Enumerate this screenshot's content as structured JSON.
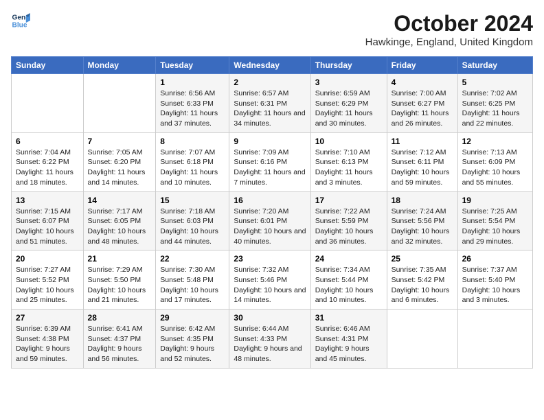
{
  "logo": {
    "line1": "General",
    "line2": "Blue"
  },
  "title": "October 2024",
  "subtitle": "Hawkinge, England, United Kingdom",
  "days_header": [
    "Sunday",
    "Monday",
    "Tuesday",
    "Wednesday",
    "Thursday",
    "Friday",
    "Saturday"
  ],
  "weeks": [
    [
      {
        "day": "",
        "sunrise": "",
        "sunset": "",
        "daylight": ""
      },
      {
        "day": "",
        "sunrise": "",
        "sunset": "",
        "daylight": ""
      },
      {
        "day": "1",
        "sunrise": "Sunrise: 6:56 AM",
        "sunset": "Sunset: 6:33 PM",
        "daylight": "Daylight: 11 hours and 37 minutes."
      },
      {
        "day": "2",
        "sunrise": "Sunrise: 6:57 AM",
        "sunset": "Sunset: 6:31 PM",
        "daylight": "Daylight: 11 hours and 34 minutes."
      },
      {
        "day": "3",
        "sunrise": "Sunrise: 6:59 AM",
        "sunset": "Sunset: 6:29 PM",
        "daylight": "Daylight: 11 hours and 30 minutes."
      },
      {
        "day": "4",
        "sunrise": "Sunrise: 7:00 AM",
        "sunset": "Sunset: 6:27 PM",
        "daylight": "Daylight: 11 hours and 26 minutes."
      },
      {
        "day": "5",
        "sunrise": "Sunrise: 7:02 AM",
        "sunset": "Sunset: 6:25 PM",
        "daylight": "Daylight: 11 hours and 22 minutes."
      }
    ],
    [
      {
        "day": "6",
        "sunrise": "Sunrise: 7:04 AM",
        "sunset": "Sunset: 6:22 PM",
        "daylight": "Daylight: 11 hours and 18 minutes."
      },
      {
        "day": "7",
        "sunrise": "Sunrise: 7:05 AM",
        "sunset": "Sunset: 6:20 PM",
        "daylight": "Daylight: 11 hours and 14 minutes."
      },
      {
        "day": "8",
        "sunrise": "Sunrise: 7:07 AM",
        "sunset": "Sunset: 6:18 PM",
        "daylight": "Daylight: 11 hours and 10 minutes."
      },
      {
        "day": "9",
        "sunrise": "Sunrise: 7:09 AM",
        "sunset": "Sunset: 6:16 PM",
        "daylight": "Daylight: 11 hours and 7 minutes."
      },
      {
        "day": "10",
        "sunrise": "Sunrise: 7:10 AM",
        "sunset": "Sunset: 6:13 PM",
        "daylight": "Daylight: 11 hours and 3 minutes."
      },
      {
        "day": "11",
        "sunrise": "Sunrise: 7:12 AM",
        "sunset": "Sunset: 6:11 PM",
        "daylight": "Daylight: 10 hours and 59 minutes."
      },
      {
        "day": "12",
        "sunrise": "Sunrise: 7:13 AM",
        "sunset": "Sunset: 6:09 PM",
        "daylight": "Daylight: 10 hours and 55 minutes."
      }
    ],
    [
      {
        "day": "13",
        "sunrise": "Sunrise: 7:15 AM",
        "sunset": "Sunset: 6:07 PM",
        "daylight": "Daylight: 10 hours and 51 minutes."
      },
      {
        "day": "14",
        "sunrise": "Sunrise: 7:17 AM",
        "sunset": "Sunset: 6:05 PM",
        "daylight": "Daylight: 10 hours and 48 minutes."
      },
      {
        "day": "15",
        "sunrise": "Sunrise: 7:18 AM",
        "sunset": "Sunset: 6:03 PM",
        "daylight": "Daylight: 10 hours and 44 minutes."
      },
      {
        "day": "16",
        "sunrise": "Sunrise: 7:20 AM",
        "sunset": "Sunset: 6:01 PM",
        "daylight": "Daylight: 10 hours and 40 minutes."
      },
      {
        "day": "17",
        "sunrise": "Sunrise: 7:22 AM",
        "sunset": "Sunset: 5:59 PM",
        "daylight": "Daylight: 10 hours and 36 minutes."
      },
      {
        "day": "18",
        "sunrise": "Sunrise: 7:24 AM",
        "sunset": "Sunset: 5:56 PM",
        "daylight": "Daylight: 10 hours and 32 minutes."
      },
      {
        "day": "19",
        "sunrise": "Sunrise: 7:25 AM",
        "sunset": "Sunset: 5:54 PM",
        "daylight": "Daylight: 10 hours and 29 minutes."
      }
    ],
    [
      {
        "day": "20",
        "sunrise": "Sunrise: 7:27 AM",
        "sunset": "Sunset: 5:52 PM",
        "daylight": "Daylight: 10 hours and 25 minutes."
      },
      {
        "day": "21",
        "sunrise": "Sunrise: 7:29 AM",
        "sunset": "Sunset: 5:50 PM",
        "daylight": "Daylight: 10 hours and 21 minutes."
      },
      {
        "day": "22",
        "sunrise": "Sunrise: 7:30 AM",
        "sunset": "Sunset: 5:48 PM",
        "daylight": "Daylight: 10 hours and 17 minutes."
      },
      {
        "day": "23",
        "sunrise": "Sunrise: 7:32 AM",
        "sunset": "Sunset: 5:46 PM",
        "daylight": "Daylight: 10 hours and 14 minutes."
      },
      {
        "day": "24",
        "sunrise": "Sunrise: 7:34 AM",
        "sunset": "Sunset: 5:44 PM",
        "daylight": "Daylight: 10 hours and 10 minutes."
      },
      {
        "day": "25",
        "sunrise": "Sunrise: 7:35 AM",
        "sunset": "Sunset: 5:42 PM",
        "daylight": "Daylight: 10 hours and 6 minutes."
      },
      {
        "day": "26",
        "sunrise": "Sunrise: 7:37 AM",
        "sunset": "Sunset: 5:40 PM",
        "daylight": "Daylight: 10 hours and 3 minutes."
      }
    ],
    [
      {
        "day": "27",
        "sunrise": "Sunrise: 6:39 AM",
        "sunset": "Sunset: 4:38 PM",
        "daylight": "Daylight: 9 hours and 59 minutes."
      },
      {
        "day": "28",
        "sunrise": "Sunrise: 6:41 AM",
        "sunset": "Sunset: 4:37 PM",
        "daylight": "Daylight: 9 hours and 56 minutes."
      },
      {
        "day": "29",
        "sunrise": "Sunrise: 6:42 AM",
        "sunset": "Sunset: 4:35 PM",
        "daylight": "Daylight: 9 hours and 52 minutes."
      },
      {
        "day": "30",
        "sunrise": "Sunrise: 6:44 AM",
        "sunset": "Sunset: 4:33 PM",
        "daylight": "Daylight: 9 hours and 48 minutes."
      },
      {
        "day": "31",
        "sunrise": "Sunrise: 6:46 AM",
        "sunset": "Sunset: 4:31 PM",
        "daylight": "Daylight: 9 hours and 45 minutes."
      },
      {
        "day": "",
        "sunrise": "",
        "sunset": "",
        "daylight": ""
      },
      {
        "day": "",
        "sunrise": "",
        "sunset": "",
        "daylight": ""
      }
    ]
  ]
}
